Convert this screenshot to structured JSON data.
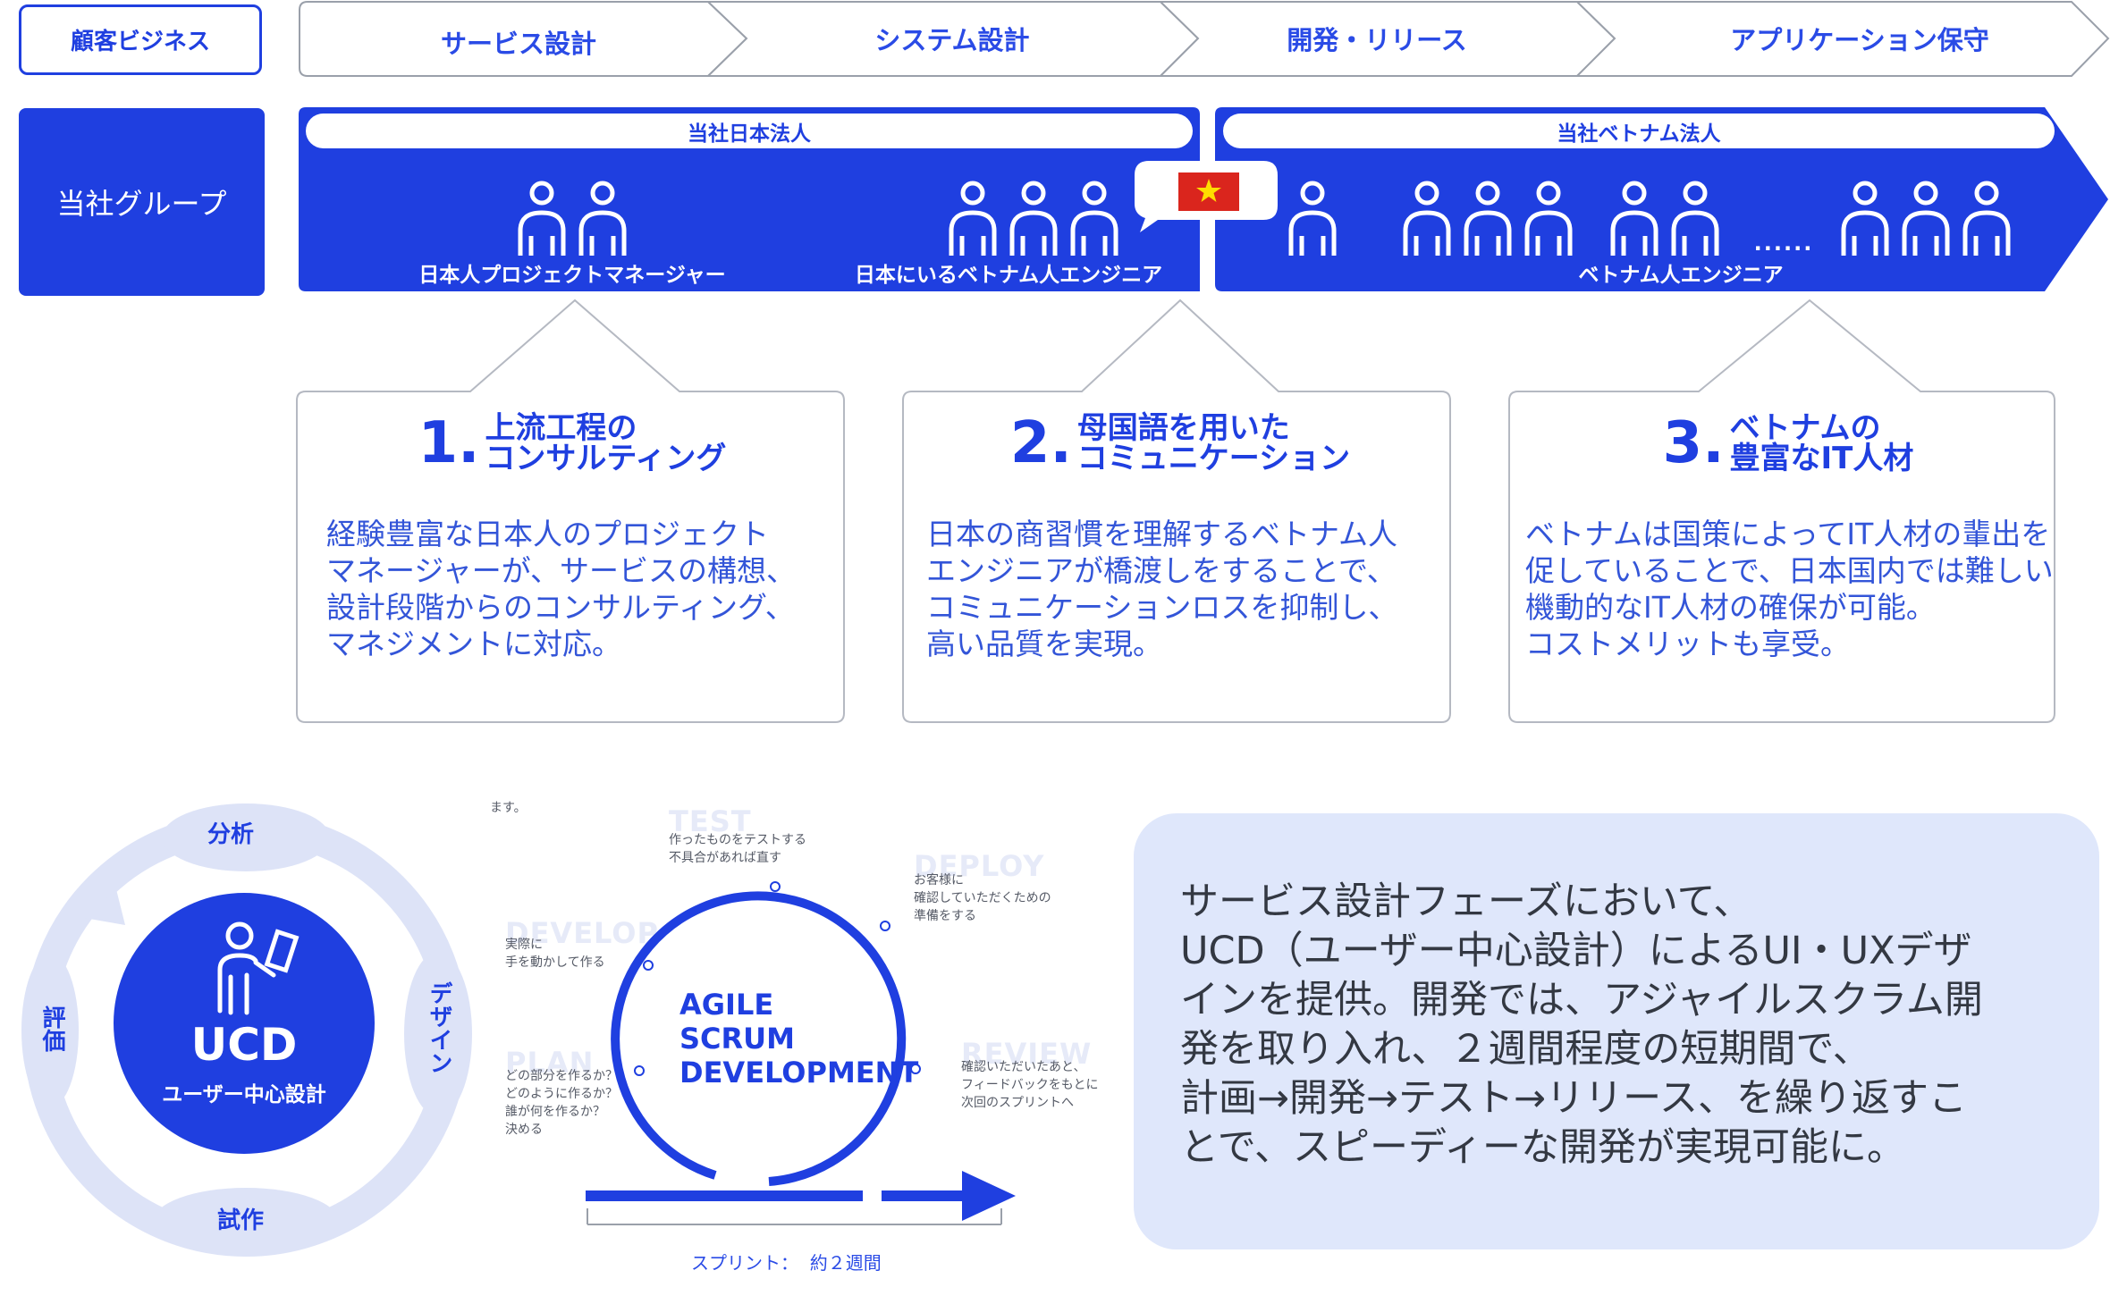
{
  "colors": {
    "brand": "#1f3fe0",
    "light": "#dfe7fb",
    "flag_red": "#da251d",
    "flag_star": "#ffdd00"
  },
  "header": {
    "customer_business": "顧客ビジネス",
    "steps": [
      "サービス設計",
      "システム設計",
      "開発・リリース",
      "アプリケーション保守"
    ]
  },
  "group": {
    "label": "当社グループ",
    "japan_entity": "当社日本法人",
    "vietnam_entity": "当社ベトナム法人",
    "pm_caption": "日本人プロジェクトマネージャー",
    "jp_vn_engineer_caption": "日本にいるベトナム人エンジニア",
    "vn_engineer_caption": "ベトナム人エンジニア",
    "dots": "......",
    "flag_icon": "vietnam-flag-icon"
  },
  "features": [
    {
      "num": "1.",
      "title_line1": "上流工程の",
      "title_line2": "コンサルティング",
      "body": "経験豊富な日本人のプロジェクト\nマネージャーが、サービスの構想、\n設計段階からのコンサルティング、\nマネジメントに対応。"
    },
    {
      "num": "2.",
      "title_line1": "母国語を用いた",
      "title_line2": "コミュニケーション",
      "body": "日本の商習慣を理解するベトナム人\nエンジニアが橋渡しをすることで、\nコミュニケーションロスを抑制し、\n高い品質を実現。"
    },
    {
      "num": "3.",
      "title_line1": "ベトナムの",
      "title_line2": "豊富なIT人材",
      "body": "ベトナムは国策によってIT人材の輩出を\n促していることで、日本国内では難しい\n機動的なIT人材の確保が可能。\nコストメリットも享受。"
    }
  ],
  "ucd": {
    "cycle": [
      "分析",
      "デザイン",
      "試作",
      "評価"
    ],
    "title": "UCD",
    "subtitle": "ユーザー中心設計",
    "icon": "person-with-tablet-icon"
  },
  "agile": {
    "fragment": "ます。",
    "center": [
      "AGILE",
      "SCRUM",
      "DEVELOPMENT"
    ],
    "phases": [
      {
        "ghost": "TEST",
        "desc": "作ったものをテストする\n不具合があれば直す"
      },
      {
        "ghost": "DEPLOY",
        "desc": "お客様に\n確認していただくための\n準備をする"
      },
      {
        "ghost": "DEVELOP",
        "desc": "実際に\n手を動かして作る"
      },
      {
        "ghost": "PLAN",
        "desc": "どの部分を作るか？\nどのように作るか？\n誰が何を作るか？\n決める"
      },
      {
        "ghost": "REVIEW",
        "desc": "確認いただいたあと、\nフィードバックをもとに\n次回のスプリントへ"
      }
    ],
    "sprint": "スプリント：  約２週間"
  },
  "summary": {
    "lines": [
      "サービス設計フェーズにおいて、",
      "UCD（ユーザー中心設計）によるUI・UXデザ",
      "インを提供。開発では、アジャイルスクラム開",
      "発を取り入れ、２週間程度の短期間で、",
      "計画→開発→テスト→リリース、を繰り返すこ",
      "とで、スピーディーな開発が実現可能に。"
    ]
  }
}
